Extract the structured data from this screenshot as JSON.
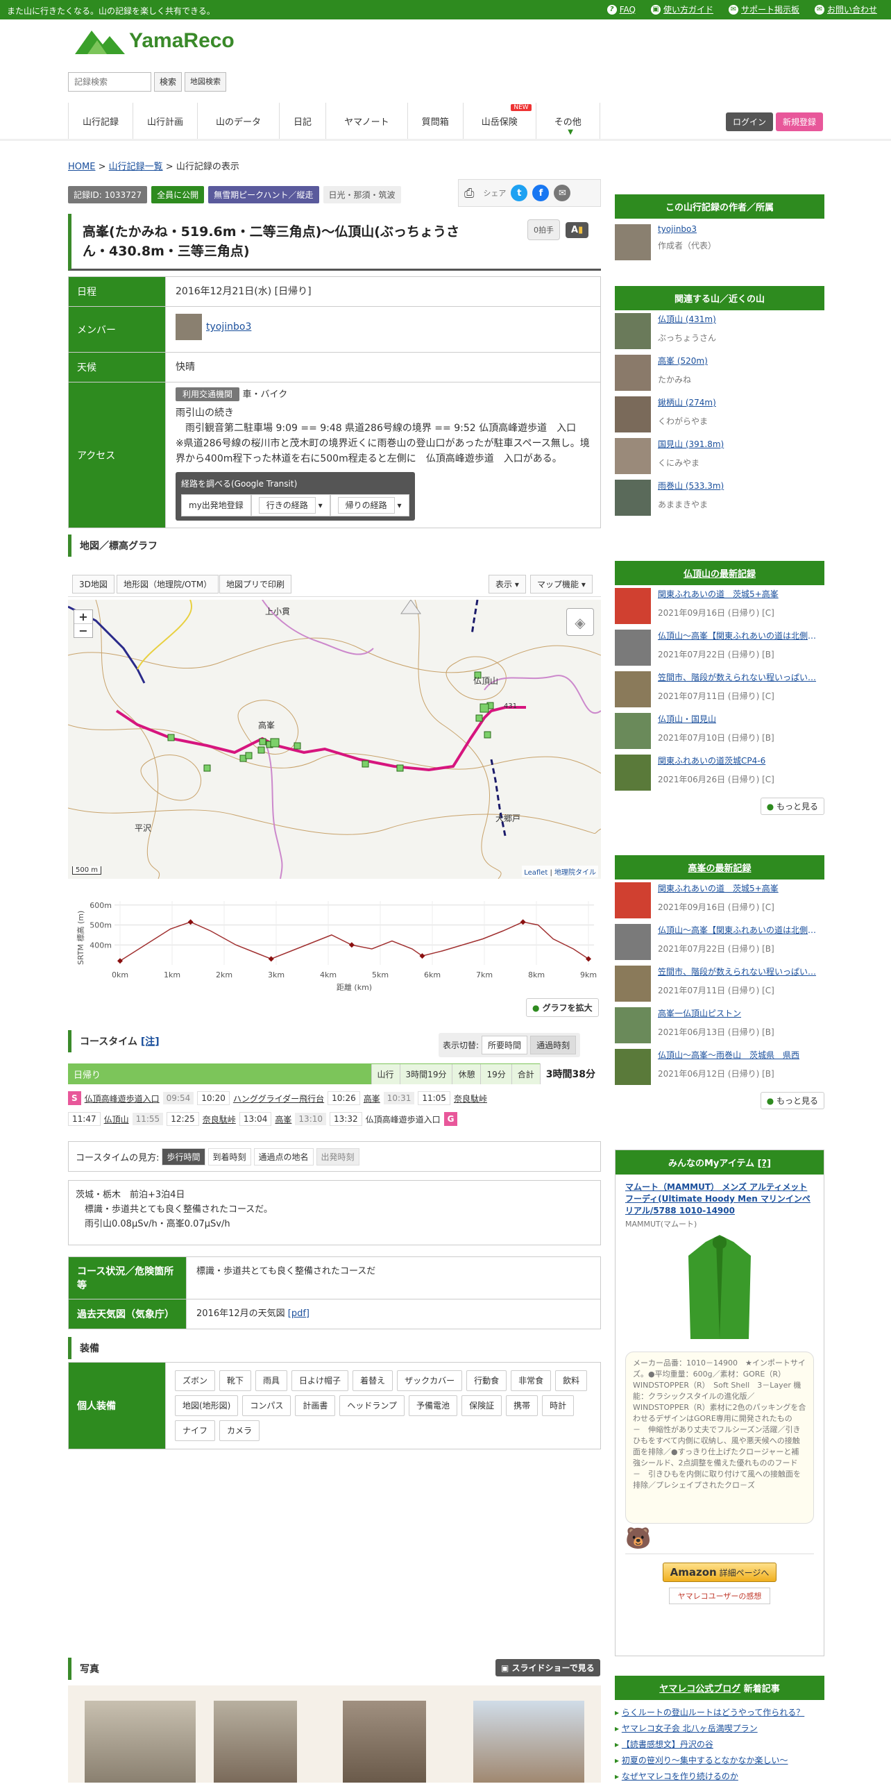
{
  "topbar": {
    "tagline": "また山に行きたくなる。山の記録を楽しく共有できる。",
    "faq": "FAQ",
    "guide": "使い方ガイド",
    "support": "サポート掲示板",
    "contact": "お問い合わせ"
  },
  "logo": {
    "text": "YamaReco"
  },
  "search": {
    "placeholder": "記録検索",
    "button": "検索",
    "map_button": "地図検索"
  },
  "nav": {
    "items": [
      "山行記録",
      "山行計画",
      "山のデータ",
      "日記",
      "ヤマノート",
      "質問箱",
      "山岳保険",
      "その他"
    ],
    "new_badge": "NEW",
    "login": "ログイン",
    "signup": "新規登録"
  },
  "breadcrumb": {
    "home": "HOME",
    "list": "山行記録一覧",
    "current": "山行記録の表示",
    "sep": ">"
  },
  "badges": {
    "record_id": "記録ID: 1033727",
    "public": "全員に公開",
    "type": "無雪期ピークハント／縦走",
    "area": "日光・那須・筑波"
  },
  "share": {
    "label": "シェア"
  },
  "record": {
    "title": "高峯(たかみね・519.6m・二等三角点)～仏頂山(ぶっちょうさん・430.8m・三等三角点)",
    "applause": "0拍手",
    "font_btn": "A"
  },
  "info": {
    "date_label": "日程",
    "date": "2016年12月21日(水) [日帰り]",
    "member_label": "メンバー",
    "member": "tyojinbo3",
    "weather_label": "天候",
    "weather": "快晴",
    "access_label": "アクセス",
    "transport_tag": "利用交通機関",
    "transport": "車・バイク",
    "access_text1": "雨引山の続き",
    "access_text2": "　雨引観音第二駐車場 9:09 == 9:48 県道286号線の境界 == 9:52 仏頂高峰遊歩道　入口",
    "access_text3": "※県道286号線の桜川市と茂木町の境界近くに雨巻山の登山口があったが駐車スペース無し。境界から400m程下った林道を右に500m程走ると左側に　仏頂高峰遊歩道　入口がある。",
    "route_title": "経路を調べる(Google Transit)",
    "route_btn1": "my出発地登録",
    "route_btn2": "行きの経路",
    "route_btn3": "帰りの経路"
  },
  "map_section": {
    "title": "地図／標高グラフ",
    "tools": [
      "3D地図",
      "地形図（地理院/OTM）",
      "地図プリで印刷"
    ],
    "display": "表示",
    "map_func": "マップ機能",
    "scale": "500 m",
    "credit_leaflet": "Leaflet",
    "credit_gsi": "地理院タイル",
    "zoom_in": "+",
    "zoom_out": "−",
    "labels": [
      "上小貫",
      "仏頂山",
      "高峯",
      "平沢",
      "大郷戸"
    ],
    "peak_label": "431"
  },
  "chart_data": {
    "type": "line",
    "ylabel": "SRTM 標高 (m)",
    "xlabel": "距離 (km)",
    "x_ticks": [
      "0km",
      "1km",
      "2km",
      "3km",
      "4km",
      "5km",
      "6km",
      "7km",
      "8km",
      "9km"
    ],
    "y_ticks": [
      "600m",
      "500m",
      "400m"
    ],
    "ylim": [
      300,
      620
    ],
    "x": [
      0,
      0.5,
      1.0,
      1.4,
      1.8,
      2.3,
      2.7,
      3.0,
      3.4,
      3.8,
      4.2,
      4.6,
      5.0,
      5.4,
      5.8,
      6.0,
      6.4,
      6.8,
      7.2,
      7.6,
      8.0,
      8.3,
      8.6,
      9.0,
      9.3
    ],
    "y": [
      320,
      400,
      480,
      515,
      470,
      400,
      360,
      330,
      370,
      410,
      450,
      400,
      380,
      420,
      380,
      345,
      370,
      400,
      430,
      470,
      515,
      500,
      430,
      380,
      330
    ]
  },
  "chart_btn": "グラフを拡大",
  "course": {
    "title": "コースタイム",
    "note": "[注]",
    "switch_label": "表示切替:",
    "switch_a": "所要時間",
    "switch_b": "通過時刻",
    "day": "日帰り",
    "walk_label": "山行",
    "walk": "3時間19分",
    "rest_label": "休憩",
    "rest": "19分",
    "total_label": "合計",
    "total": "3時間38分",
    "start": "S",
    "goal": "G",
    "row1": [
      {
        "t": "仏頂高峰遊歩道入口",
        "k": "pt"
      },
      {
        "t": "09:54",
        "k": "tm"
      },
      {
        "t": "10:20",
        "k": "tw"
      },
      {
        "t": "ハンググライダー飛行台",
        "k": "pt"
      },
      {
        "t": "10:26",
        "k": "tw"
      },
      {
        "t": "高峯",
        "k": "pt"
      },
      {
        "t": "10:31",
        "k": "tm"
      },
      {
        "t": "11:05",
        "k": "tw"
      },
      {
        "t": "奈良駄峠",
        "k": "pt"
      }
    ],
    "row2": [
      {
        "t": "11:47",
        "k": "tw"
      },
      {
        "t": "仏頂山",
        "k": "pt"
      },
      {
        "t": "11:55",
        "k": "tm"
      },
      {
        "t": "12:25",
        "k": "tw"
      },
      {
        "t": "奈良駄峠",
        "k": "pt"
      },
      {
        "t": "13:04",
        "k": "tw"
      },
      {
        "t": "高峯",
        "k": "pt"
      },
      {
        "t": "13:10",
        "k": "tm"
      },
      {
        "t": "13:32",
        "k": "tw"
      },
      {
        "t": "仏頂高峰遊歩道入口",
        "k": "tx"
      }
    ],
    "legend_label": "コースタイムの見方:",
    "legend": [
      "歩行時間",
      "到着時刻",
      "通過点の地名",
      "出発時刻"
    ]
  },
  "notes": {
    "l1": "茨城・栃木　前泊+3泊4日",
    "l2": "　標識・歩道共とても良く整備されたコースだ。",
    "l3": "　雨引山0.08μSv/h・高峯0.07μSv/h"
  },
  "course_info": {
    "status_label": "コース状況／危険箇所等",
    "status": "標識・歩道共とても良く整備されたコースだ",
    "weather_label": "過去天気図（気象庁）",
    "weather_map": "2016年12月の天気図",
    "pdf": "[pdf]"
  },
  "gear": {
    "title": "装備",
    "label": "個人装備",
    "items": [
      "ズボン",
      "靴下",
      "雨具",
      "日よけ帽子",
      "着替え",
      "ザックカバー",
      "行動食",
      "非常食",
      "飲料",
      "地図(地形図)",
      "コンパス",
      "計画書",
      "ヘッドランプ",
      "予備電池",
      "保険証",
      "携帯",
      "時計",
      "ナイフ",
      "カメラ"
    ]
  },
  "photos": {
    "title": "写真",
    "slideshow": "スライドショーで見る"
  },
  "sidebar": {
    "author_head": "この山行記録の作者／所属",
    "author_name": "tyojinbo3",
    "author_role": "作成者（代表）",
    "mountains_head": "関連する山／近くの山",
    "mountains": [
      {
        "n": "仏頂山 (431m)",
        "s": "ぶっちょうさん"
      },
      {
        "n": "高峯 (520m)",
        "s": "たかみね"
      },
      {
        "n": "鍬柄山 (274m)",
        "s": "くわがらやま"
      },
      {
        "n": "国見山 (391.8m)",
        "s": "くにみやま"
      },
      {
        "n": "雨巻山 (533.3m)",
        "s": "あままきやま"
      }
    ],
    "latest1_head": "仏頂山の最新記録",
    "latest1": [
      {
        "n": "関東ふれあいの道　茨城5+高峯",
        "s": "2021年09月16日 (日帰り) [C]"
      },
      {
        "n": "仏頂山～高峯【関東ふれあいの道は北側から…",
        "s": "2021年07月22日 (日帰り) [B]"
      },
      {
        "n": "笠間市、階段が数えられない程いっぱい…",
        "s": "2021年07月11日 (日帰り) [C]"
      },
      {
        "n": "仏頂山・国見山",
        "s": "2021年07月10日 (日帰り) [B]"
      },
      {
        "n": "関東ふれあいの道茨城CP4-6",
        "s": "2021年06月26日 (日帰り) [C]"
      }
    ],
    "more": "もっと見る",
    "latest2_head": "高峯の最新記録",
    "latest2": [
      {
        "n": "関東ふれあいの道　茨城5+高峯",
        "s": "2021年09月16日 (日帰り) [C]"
      },
      {
        "n": "仏頂山～高峯【関東ふれあいの道は北側から…",
        "s": "2021年07月22日 (日帰り) [B]"
      },
      {
        "n": "笠間市、階段が数えられない程いっぱい…",
        "s": "2021年07月11日 (日帰り) [C]"
      },
      {
        "n": "高峯一仏頂山ピストン",
        "s": "2021年06月13日 (日帰り) [B]"
      },
      {
        "n": "仏頂山～高峯～雨巻山　茨城県　県西",
        "s": "2021年06月12日 (日帰り) [B]"
      }
    ],
    "items_head": "みんなのMyアイテム",
    "items_note": "[?]",
    "item_name": "マムート（MAMMUT） メンズ アルティメット フーディ(Ultimate Hoody Men マリンインペリアル/5788 1010-14900",
    "item_brand": "MAMMUT(マムート)",
    "item_desc": "メーカー品番：1010－14900　★インポートサイズ。●平均重量：600g／素材：GORE（R）　WINDSTOPPER（R）　Soft Shell　3－Layer 機能：クラシックスタイルの進化版／WINDSTOPPER（R）素材に2色のパッキングを合わせるデザインはGORE専用に開発されたもの　－　伸縮性があり丈夫でフルシーズン活躍／引きひもをすべて内側に収納し、風や悪天候への接触面を排除／●すっきり仕上げたクロージャーと補強シールド、2点調整を備えた優れもののフード　－　引きひもを内側に取り付けて風への接触面を排除／プレシェイプされたクロ－ズ",
    "amazon": "Amazon",
    "amazon_detail": "詳細ページへ",
    "review": "ヤマレコユーザーの感想",
    "blog_head": "ヤマレコ公式ブログ",
    "blog_sub": "新着記事",
    "blog": [
      "らくルートの登山ルートはどうやって作られる？",
      "ヤマレコ女子会 北八ヶ岳満喫プラン",
      "【読書感想文】丹沢の谷",
      "初夏の笹刈り～集中するとなかなか楽しい～",
      "なぜヤマレコを作り続けるのか"
    ]
  },
  "colors": {
    "green": "#2e8b1f",
    "light_green": "#7cc55a",
    "purple": "#5a5a9c",
    "pink": "#e8579a",
    "route": "#d6157e"
  }
}
